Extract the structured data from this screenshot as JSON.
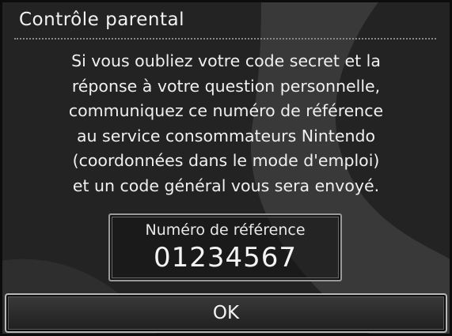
{
  "dialog": {
    "title": "Contrôle parental",
    "message_lines": [
      "Si vous oubliez votre code secret et la",
      "réponse à votre question personnelle,",
      "communiquez ce numéro de référence",
      "au service consommateurs Nintendo",
      "(coordonnées dans le mode d'emploi)",
      "et un code général vous sera envoyé."
    ],
    "reference": {
      "label": "Numéro de référence",
      "number": "01234567"
    },
    "ok_label": "OK"
  },
  "colors": {
    "background": "#232323",
    "text": "#f0f0f0",
    "border": "#9a9a9a"
  }
}
